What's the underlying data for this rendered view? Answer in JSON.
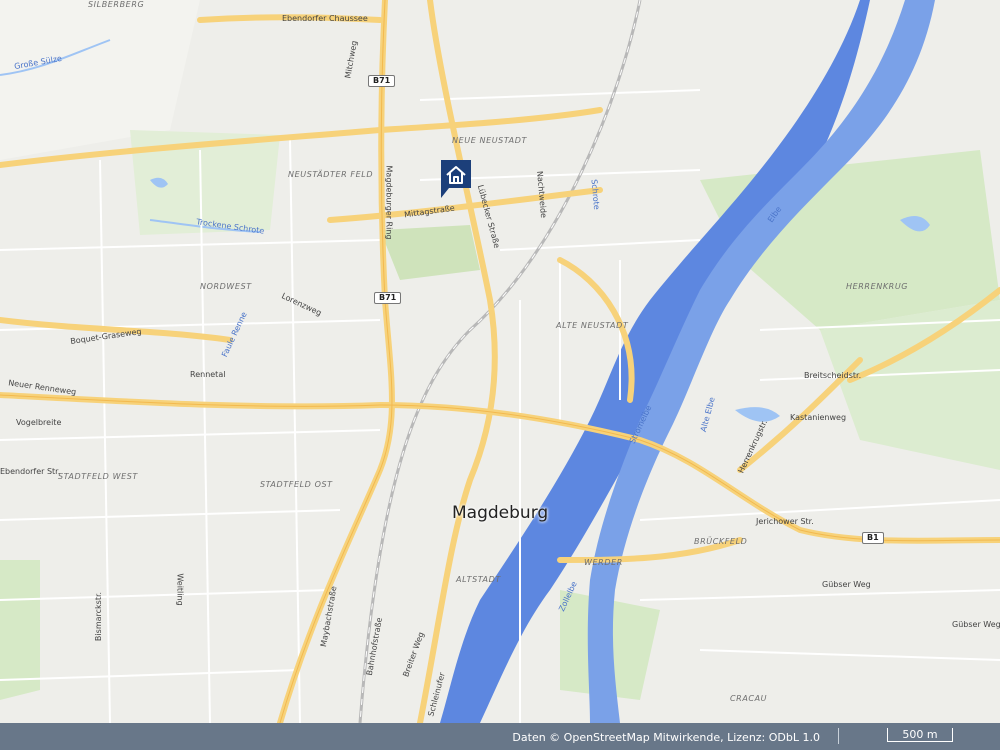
{
  "map": {
    "city_label": "Magdeburg",
    "districts": [
      "SILBERBERG",
      "NEUE NEUSTADT",
      "NEUSTÄDTER FELD",
      "NORDWEST",
      "ALTE NEUSTADT",
      "STADTFELD WEST",
      "STADTFELD OST",
      "ALTSTADT",
      "WERDER",
      "BRÜCKFELD",
      "CRACAU",
      "HERRENKRUG"
    ],
    "streets": [
      "Ebendorfer Chaussee",
      "Mittagstraße",
      "Lorenzweg",
      "Boquet-Graseweg",
      "Neuer Renneweg",
      "Vogelbreite",
      "Rennetal",
      "Magdeburger Ring",
      "Jerichower Str.",
      "Gübser Weg",
      "Bahnhofstraße",
      "Breiter Weg",
      "Weitling",
      "Bismarckstr.",
      "Kastanienweg",
      "Herrenkrugstr.",
      "Breitscheidstr.",
      "Nachtweide",
      "Lübecker Straße",
      "Mitchweg",
      "Maybachstraße",
      "Schleinufer",
      "Ebendorfer Str.",
      "Gübser Weg 2"
    ],
    "waterways": [
      "Elbe",
      "Stromelbe",
      "Alte Elbe",
      "Große Sülze",
      "Trockene Schrote",
      "Schrote",
      "Zollelbe",
      "Faule Renne"
    ],
    "road_shields": [
      "B71",
      "B71",
      "B1"
    ],
    "colors": {
      "water": "#9fc4f4",
      "river": "#5d87e0",
      "major_road": "#f7d27a",
      "land": "#eeeeea",
      "park": "#d6e9c6",
      "pin": "#1c3f7a"
    }
  },
  "marker": {
    "icon": "house-icon"
  },
  "footer": {
    "attribution": "Daten © OpenStreetMap Mitwirkende, Lizenz: ODbL 1.0",
    "scale": "500 m"
  }
}
